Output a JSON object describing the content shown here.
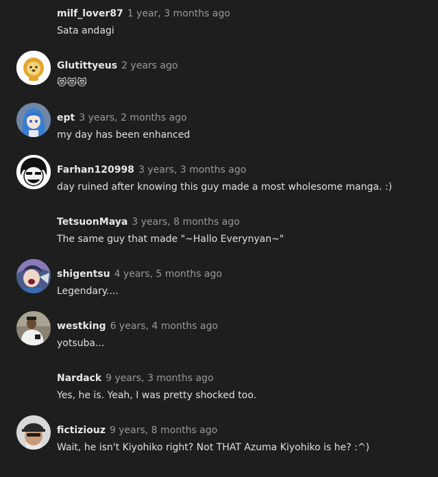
{
  "comments": [
    {
      "username": "milf_lover87",
      "time": "1 year, 3 months ago",
      "text": "Sata andagi",
      "avatar": "none"
    },
    {
      "username": "Glutittyeus",
      "time": "2 years ago",
      "text": "😻😻😻",
      "avatar": "lion-cartoon-icon"
    },
    {
      "username": "ept",
      "time": "3 years, 2 months ago",
      "text": "my day has been enhanced",
      "avatar": "anime-girl-blue-hair"
    },
    {
      "username": "Farhan120998",
      "time": "3 years, 3 months ago",
      "text": "day ruined after knowing this guy made a most wholesome manga. :)",
      "avatar": "bw-cartoon-face"
    },
    {
      "username": "TetsuonMaya",
      "time": "3 years, 8 months ago",
      "text": "The same guy that made \"~Hallo Everynyan~\"",
      "avatar": "none"
    },
    {
      "username": "shigentsu",
      "time": "4 years, 5 months ago",
      "text": "Legendary....",
      "avatar": "anime-character-shouting"
    },
    {
      "username": "westking",
      "time": "6 years, 4 months ago",
      "text": "yotsuba...",
      "avatar": "person-photo"
    },
    {
      "username": "Nardack",
      "time": "9 years, 3 months ago",
      "text": "Yes, he is. Yeah, I was pretty shocked too.",
      "avatar": "none"
    },
    {
      "username": "fictiziouz",
      "time": "9 years, 8 months ago",
      "text": "Wait, he isn't Kiyohiko right? Not THAT Azuma Kiyohiko is he? :^)",
      "avatar": "person-with-cap-photo"
    }
  ]
}
